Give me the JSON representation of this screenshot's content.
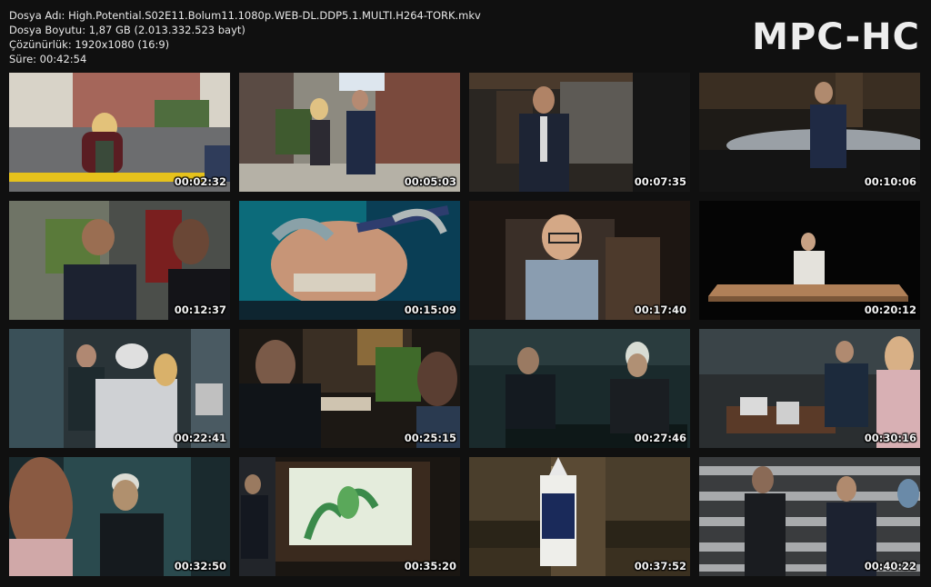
{
  "info": {
    "filename": "Dosya Adı: High.Potential.S02E11.Bolum11.1080p.WEB-DL.DDP5.1.MULTI.H264-TORK.mkv",
    "filesize": "Dosya Boyutu: 1,87 GB (2.013.332.523 bayt)",
    "resolution": "Çözünürlük: 1920x1080 (16:9)",
    "duration": "Süre: 00:42:54"
  },
  "brand": "MPC-HC",
  "thumbnails": [
    {
      "time": "00:02:32"
    },
    {
      "time": "00:05:03"
    },
    {
      "time": "00:07:35"
    },
    {
      "time": "00:10:06"
    },
    {
      "time": "00:12:37"
    },
    {
      "time": "00:15:09"
    },
    {
      "time": "00:17:40"
    },
    {
      "time": "00:20:12"
    },
    {
      "time": "00:22:41"
    },
    {
      "time": "00:25:15"
    },
    {
      "time": "00:27:46"
    },
    {
      "time": "00:30:16"
    },
    {
      "time": "00:32:50"
    },
    {
      "time": "00:35:20"
    },
    {
      "time": "00:37:52"
    },
    {
      "time": "00:40:22"
    }
  ]
}
